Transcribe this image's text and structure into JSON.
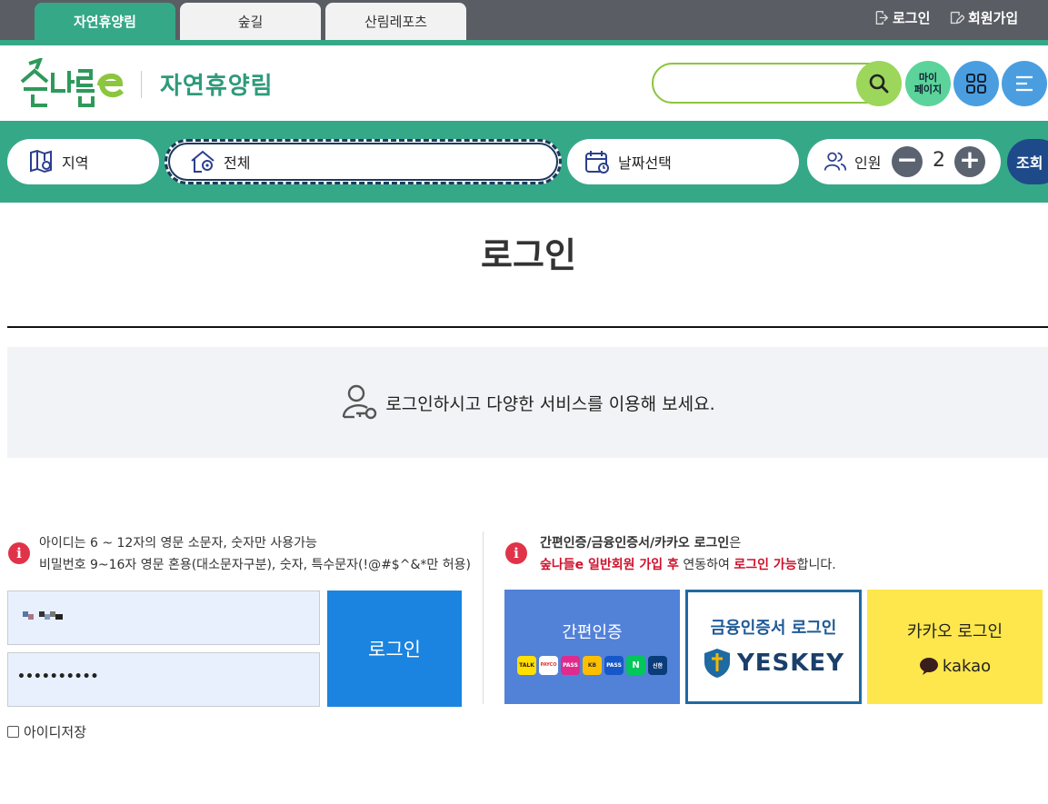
{
  "tabs": [
    {
      "label": "자연휴양림",
      "active": true
    },
    {
      "label": "숲길",
      "active": false
    },
    {
      "label": "산림레포츠",
      "active": false
    }
  ],
  "top_links": {
    "login": "로그인",
    "signup": "회원가입"
  },
  "header": {
    "logo_text": "숲나들e",
    "site_title": "자연휴양림",
    "search_placeholder": "",
    "mypage_label_line1": "마이",
    "mypage_label_line2": "페이지"
  },
  "filter": {
    "region_label": "지역",
    "facility_label": "전체",
    "date_label": "날짜선택",
    "people_label": "인원",
    "people_count": "2",
    "minus": "−",
    "plus": "+",
    "lookup_label": "조회"
  },
  "page": {
    "title": "로그인",
    "banner_text": "로그인하시고 다양한 서비스를 이용해 보세요."
  },
  "login_form": {
    "info_icon": "i",
    "hint_line1": "아이디는 6 ~ 12자의 영문 소문자, 숫자만 사용가능",
    "hint_line2": "비밀번호 9~16자 영문 혼용(대소문자구분), 숫자, 특수문자(!@#$^&*만 허용)",
    "password_dots": "••••••••••",
    "login_button": "로그인",
    "save_id_label": "아이디저장"
  },
  "alt_login": {
    "info_icon": "i",
    "notice_bold": "간편인증/금융인증서/카카오 로그인",
    "notice_suffix": "은",
    "notice2_red1": "숲나들e 일반회원 가입 후",
    "notice2_mid": " 연동하여 ",
    "notice2_red2": "로그인 가능",
    "notice2_end": "합니다.",
    "simple_auth": "간편인증",
    "simple_auth_providers": [
      "TALK",
      "PAYCO",
      "PASS",
      "KB",
      "PASS",
      "N",
      "신한"
    ],
    "finance_cert": "금융인증서 로그인",
    "yeskey_text": "YESKEY",
    "kakao_login": "카카오 로그인",
    "kakao_text": "kakao"
  },
  "colors": {
    "brand_green": "#35a888",
    "topbar_gray": "#5a5d63",
    "login_blue": "#1a84e0",
    "simple_auth_blue": "#5281d8",
    "kakao_yellow": "#fde74c",
    "notice_red": "#d0102b"
  }
}
